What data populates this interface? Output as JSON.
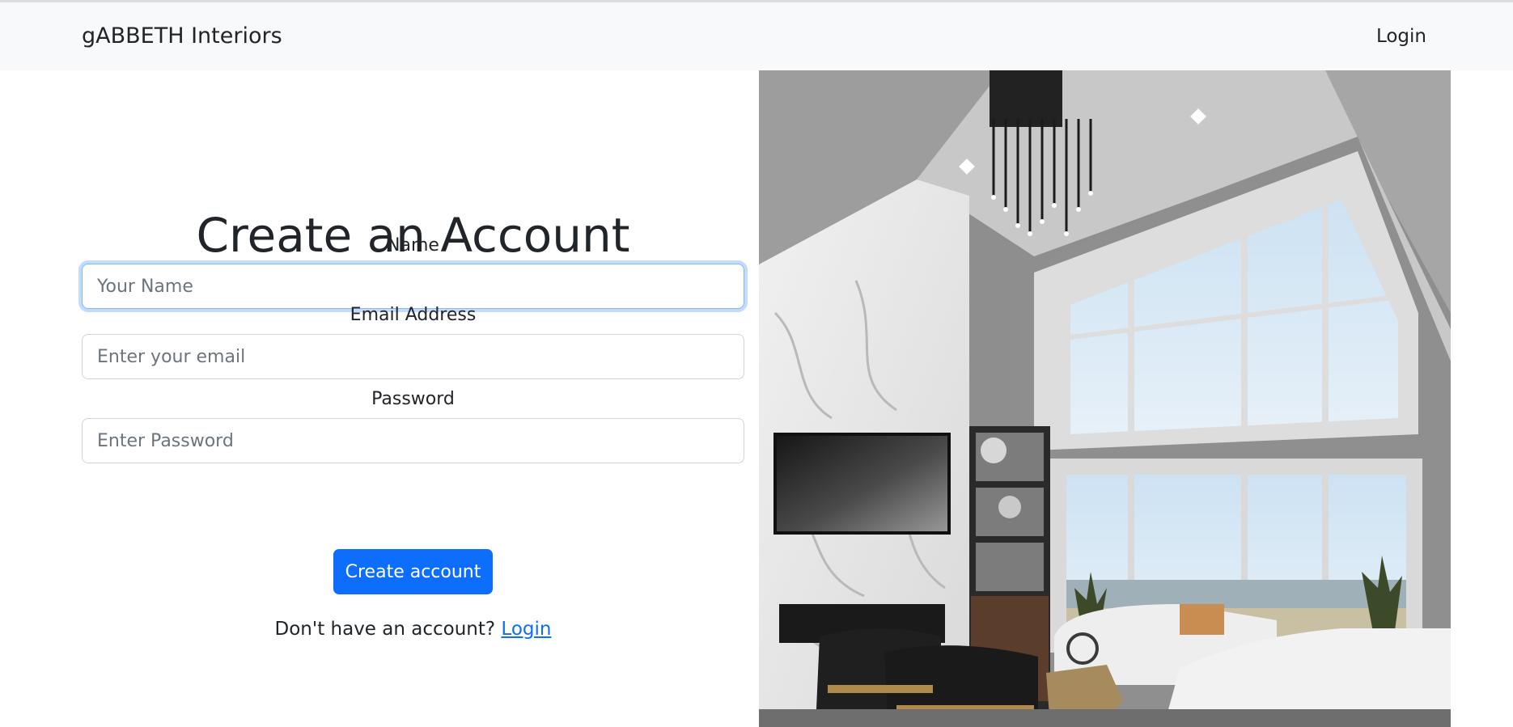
{
  "navbar": {
    "brand": "gABBETH Interiors",
    "login_link": "Login"
  },
  "form": {
    "title": "Create an Account",
    "name_label": "Name",
    "name_placeholder": "Your Name",
    "email_label": "Email Address",
    "email_placeholder": "Enter your email",
    "password_label": "Password",
    "password_placeholder": "Enter Password",
    "submit_label": "Create account",
    "footer_text": "Don't have an account? ",
    "footer_link": "Login"
  },
  "image": {
    "subject": "living-room-interior-photo"
  },
  "colors": {
    "primary": "#0d6efd",
    "navbar_bg": "#f8f9fa",
    "text": "#212529"
  }
}
